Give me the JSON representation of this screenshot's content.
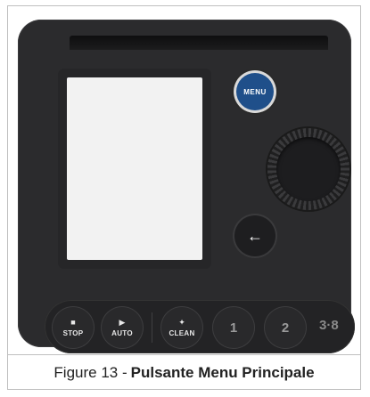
{
  "device": {
    "menu_label": "MENU",
    "back_symbol": "←",
    "bottom_buttons": [
      {
        "symbol": "■",
        "label": "STOP"
      },
      {
        "symbol": "▶",
        "label": "AUTO"
      },
      {
        "symbol": "✦",
        "label": "CLEAN"
      },
      {
        "number": "1"
      },
      {
        "number": "2"
      }
    ],
    "range_label": "3·8"
  },
  "caption": {
    "prefix": "Figure 13 -",
    "bold": "Pulsante Menu Principale"
  },
  "colors": {
    "body": "#2b2b2d",
    "menu_button": "#1f4f8a",
    "screen": "#f2f2f2"
  }
}
